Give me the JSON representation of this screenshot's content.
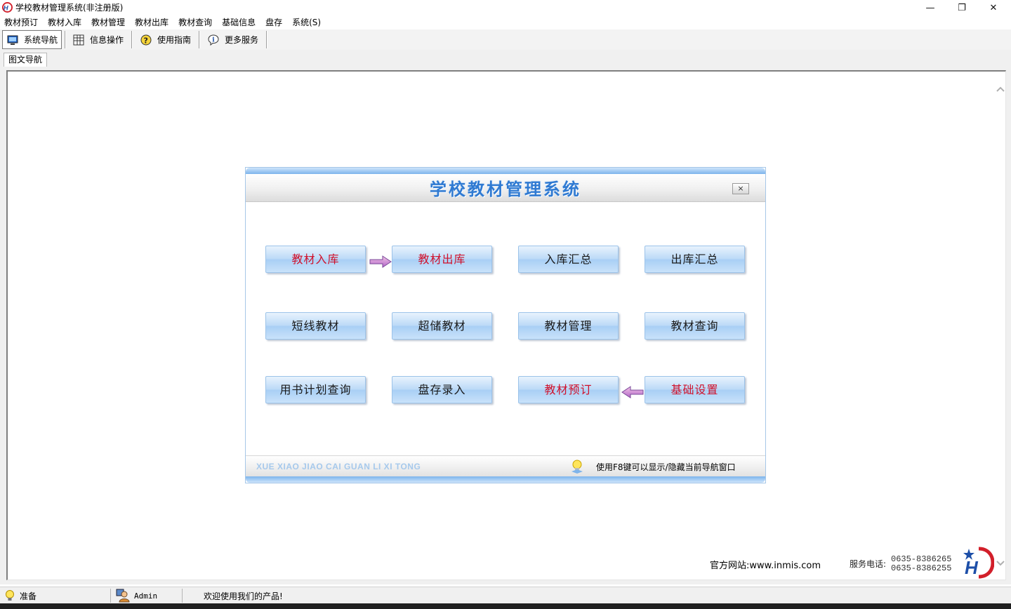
{
  "window": {
    "title": "学校教材管理系统(非注册版)",
    "controls": {
      "minimize": "—",
      "restore": "❐",
      "close": "✕"
    }
  },
  "menu": [
    "教材预订",
    "教材入库",
    "教材管理",
    "教材出库",
    "教材查询",
    "基础信息",
    "盘存",
    "系统(S)"
  ],
  "toolbar": {
    "nav": "系统导航",
    "info": "信息操作",
    "guide": "使用指南",
    "more": "更多服务"
  },
  "tab": {
    "label": "图文导航"
  },
  "dialog": {
    "title": "学校教材管理系统",
    "close": "×",
    "buttons": [
      {
        "label": "教材入库",
        "red": true
      },
      {
        "label": "教材出库",
        "red": true
      },
      {
        "label": "入库汇总",
        "red": false
      },
      {
        "label": "出库汇总",
        "red": false
      },
      {
        "label": "短线教材",
        "red": false
      },
      {
        "label": "超储教材",
        "red": false
      },
      {
        "label": "教材管理",
        "red": false
      },
      {
        "label": "教材查询",
        "red": false
      },
      {
        "label": "用书计划查询",
        "red": false
      },
      {
        "label": "盘存录入",
        "red": false
      },
      {
        "label": "教材预订",
        "red": true
      },
      {
        "label": "基础设置",
        "red": true
      }
    ],
    "footer_pinyin": "XUE XIAO JIAO CAI GUAN LI XI TONG",
    "footer_hint": "使用F8键可以显示/隐藏当前导航窗口"
  },
  "info": {
    "website": "官方网站:www.inmis.com",
    "phone_label": "服务电话:",
    "phones": [
      "0635-8386265",
      "0635-8386255"
    ]
  },
  "status": {
    "ready": "准备",
    "user": "Admin",
    "welcome": "欢迎使用我们的产品!"
  },
  "colors": {
    "accent_blue": "#2f7ad2",
    "red_label": "#d0102a",
    "button_blue": "#bcdaf7"
  }
}
